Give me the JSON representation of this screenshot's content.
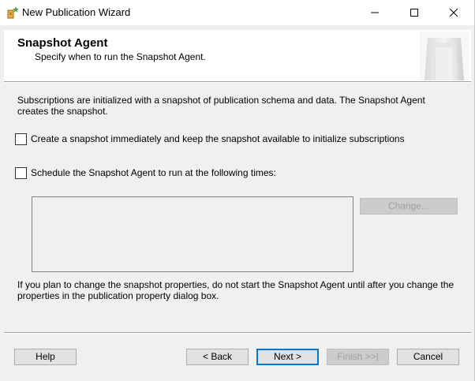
{
  "window": {
    "title": "New Publication Wizard",
    "minimize_icon": "minimize-icon",
    "maximize_icon": "maximize-icon",
    "close_icon": "close-icon"
  },
  "header": {
    "title": "Snapshot Agent",
    "subtitle": "Specify when to run the Snapshot Agent."
  },
  "main": {
    "description": "Subscriptions are initialized with a snapshot of publication schema and data. The Snapshot Agent creates the snapshot.",
    "create_snapshot_label": "Create a snapshot immediately and keep the snapshot available to initialize subscriptions",
    "create_snapshot_checked": false,
    "schedule_label": "Schedule the Snapshot Agent to run at the following times:",
    "schedule_checked": false,
    "change_button": "Change...",
    "note": "If you plan to change the snapshot properties, do not start the Snapshot Agent until after you change the properties in the publication property dialog box."
  },
  "footer": {
    "help": "Help",
    "back": "< Back",
    "next": "Next >",
    "finish": "Finish >>|",
    "cancel": "Cancel"
  }
}
